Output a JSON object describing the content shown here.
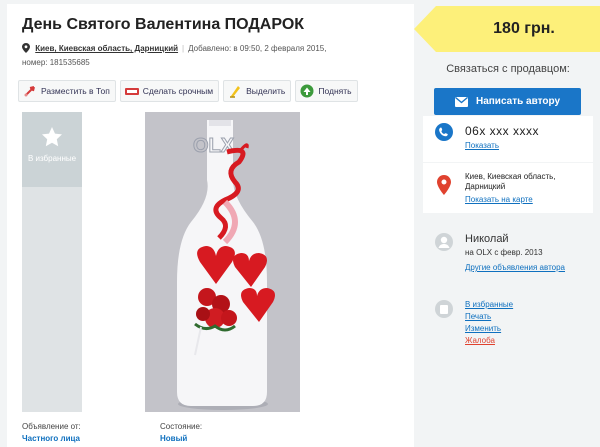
{
  "listing": {
    "title": "День Святого Валентина ПОДАРОК",
    "location": "Киев, Киевская область, Дарницкий",
    "added": "Добавлено: в 09:50, 2 февраля 2015,",
    "number": "номер: 181535685",
    "actions": [
      {
        "label": "Разместить в Топ",
        "icon": "rocket-icon"
      },
      {
        "label": "Сделать срочным",
        "icon": "urgent-icon"
      },
      {
        "label": "Выделить",
        "icon": "highlight-icon"
      },
      {
        "label": "Поднять",
        "icon": "raise-icon"
      }
    ],
    "favorite_label": "В избранные",
    "photo_watermark": "OLX",
    "details": [
      {
        "key": "Объявление от:",
        "value": "Частного лица"
      },
      {
        "key": "Состояние:",
        "value": "Новый"
      }
    ]
  },
  "sidebar": {
    "price": "180 грн.",
    "contact_title": "Связаться с продавцом:",
    "write_button": "Написать автору",
    "phone": "06x xxx xxxx",
    "show_phone": "Показать",
    "address": [
      "Киев, Киевская область,",
      "Дарницкий"
    ],
    "show_map": "Показать на карте",
    "user_name": "Николай",
    "user_since": "на OLX с февр. 2013",
    "other_ads": "Другие объявления автора",
    "links": [
      {
        "label": "В избранные"
      },
      {
        "label": "Печать"
      },
      {
        "label": "Изменить"
      },
      {
        "label": "Жалоба"
      }
    ]
  },
  "colors": {
    "accent": "#1a76c8",
    "link": "#0f70bf",
    "price_bg": "#fdf07a",
    "complaint": "#e0422f"
  }
}
